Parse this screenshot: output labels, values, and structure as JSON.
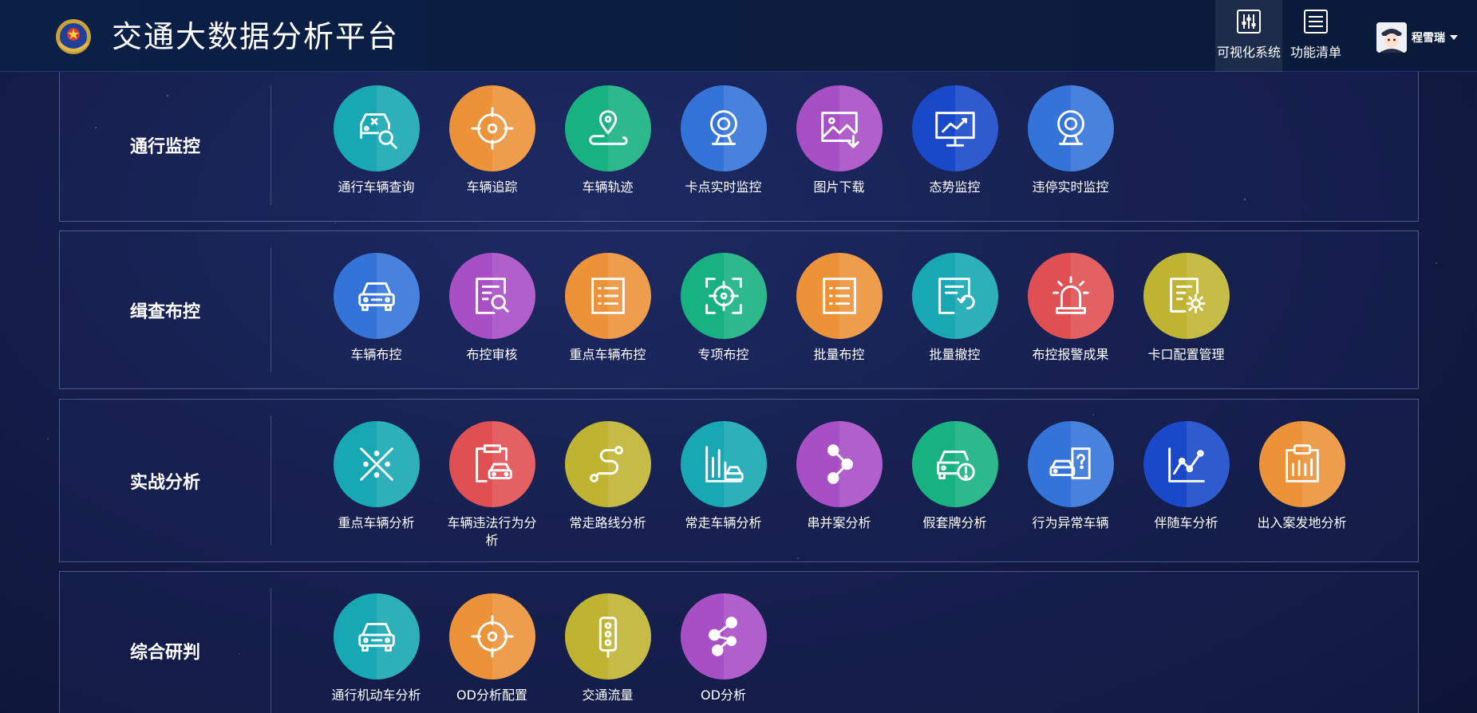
{
  "header": {
    "title": "交通大数据分析平台",
    "nav": [
      {
        "label": "可视化系统",
        "icon": "sliders-icon",
        "active": true
      },
      {
        "label": "功能清单",
        "icon": "list-icon",
        "active": false
      }
    ],
    "user": {
      "name": "程雪瑞"
    }
  },
  "colors": {
    "teal": "#17a8b4",
    "orange": "#ec9238",
    "green": "#17b27f",
    "blue": "#3474d9",
    "purple": "#a94fc6",
    "navy": "#1949c9",
    "red": "#e04f52",
    "olive": "#bfb431"
  },
  "sections": [
    {
      "name": "通行监控",
      "items": [
        {
          "label": "通行车辆查询",
          "icon": "car-search-icon",
          "color": "#17a8b4"
        },
        {
          "label": "车辆追踪",
          "icon": "crosshair-icon",
          "color": "#ec9238"
        },
        {
          "label": "车辆轨迹",
          "icon": "map-pin-route-icon",
          "color": "#17b27f"
        },
        {
          "label": "卡点实时监控",
          "icon": "webcam-icon",
          "color": "#3474d9"
        },
        {
          "label": "图片下载",
          "icon": "image-download-icon",
          "color": "#a94fc6"
        },
        {
          "label": "态势监控",
          "icon": "monitor-chart-icon",
          "color": "#1949c9"
        },
        {
          "label": "违停实时监控",
          "icon": "webcam-icon",
          "color": "#3474d9"
        }
      ]
    },
    {
      "name": "缉查布控",
      "items": [
        {
          "label": "车辆布控",
          "icon": "car-front-icon",
          "color": "#3474d9"
        },
        {
          "label": "布控审核",
          "icon": "document-search-icon",
          "color": "#a94fc6"
        },
        {
          "label": "重点车辆布控",
          "icon": "list-board-icon",
          "color": "#ec9238"
        },
        {
          "label": "专项布控",
          "icon": "target-square-icon",
          "color": "#17b27f"
        },
        {
          "label": "批量布控",
          "icon": "list-board-icon",
          "color": "#ec9238"
        },
        {
          "label": "批量撤控",
          "icon": "document-undo-icon",
          "color": "#17a8b4"
        },
        {
          "label": "布控报警成果",
          "icon": "alarm-light-icon",
          "color": "#e04f52"
        },
        {
          "label": "卡口配置管理",
          "icon": "document-gear-icon",
          "color": "#bfb431"
        }
      ]
    },
    {
      "name": "实战分析",
      "items": [
        {
          "label": "重点车辆分析",
          "icon": "cross-dots-icon",
          "color": "#17a8b4"
        },
        {
          "label": "车辆违法行为分析",
          "icon": "clipboard-car-icon",
          "color": "#e04f52"
        },
        {
          "label": "常走路线分析",
          "icon": "route-path-icon",
          "color": "#bfb431"
        },
        {
          "label": "常走车辆分析",
          "icon": "bar-car-icon",
          "color": "#17a8b4"
        },
        {
          "label": "串并案分析",
          "icon": "linked-nodes-icon",
          "color": "#a94fc6"
        },
        {
          "label": "假套牌分析",
          "icon": "car-alert-icon",
          "color": "#17b27f"
        },
        {
          "label": "行为异常车辆",
          "icon": "car-question-icon",
          "color": "#3474d9"
        },
        {
          "label": "伴随车分析",
          "icon": "line-chart-icon",
          "color": "#1949c9"
        },
        {
          "label": "出入案发地分析",
          "icon": "clipboard-bars-icon",
          "color": "#ec9238"
        }
      ]
    },
    {
      "name": "综合研判",
      "items": [
        {
          "label": "通行机动车分析",
          "icon": "car-front-icon",
          "color": "#17a8b4"
        },
        {
          "label": "OD分析配置",
          "icon": "crosshair-icon",
          "color": "#ec9238"
        },
        {
          "label": "交通流量",
          "icon": "traffic-light-icon",
          "color": "#bfb431"
        },
        {
          "label": "OD分析",
          "icon": "linked-nodes-icon",
          "color": "#a94fc6"
        }
      ]
    }
  ]
}
